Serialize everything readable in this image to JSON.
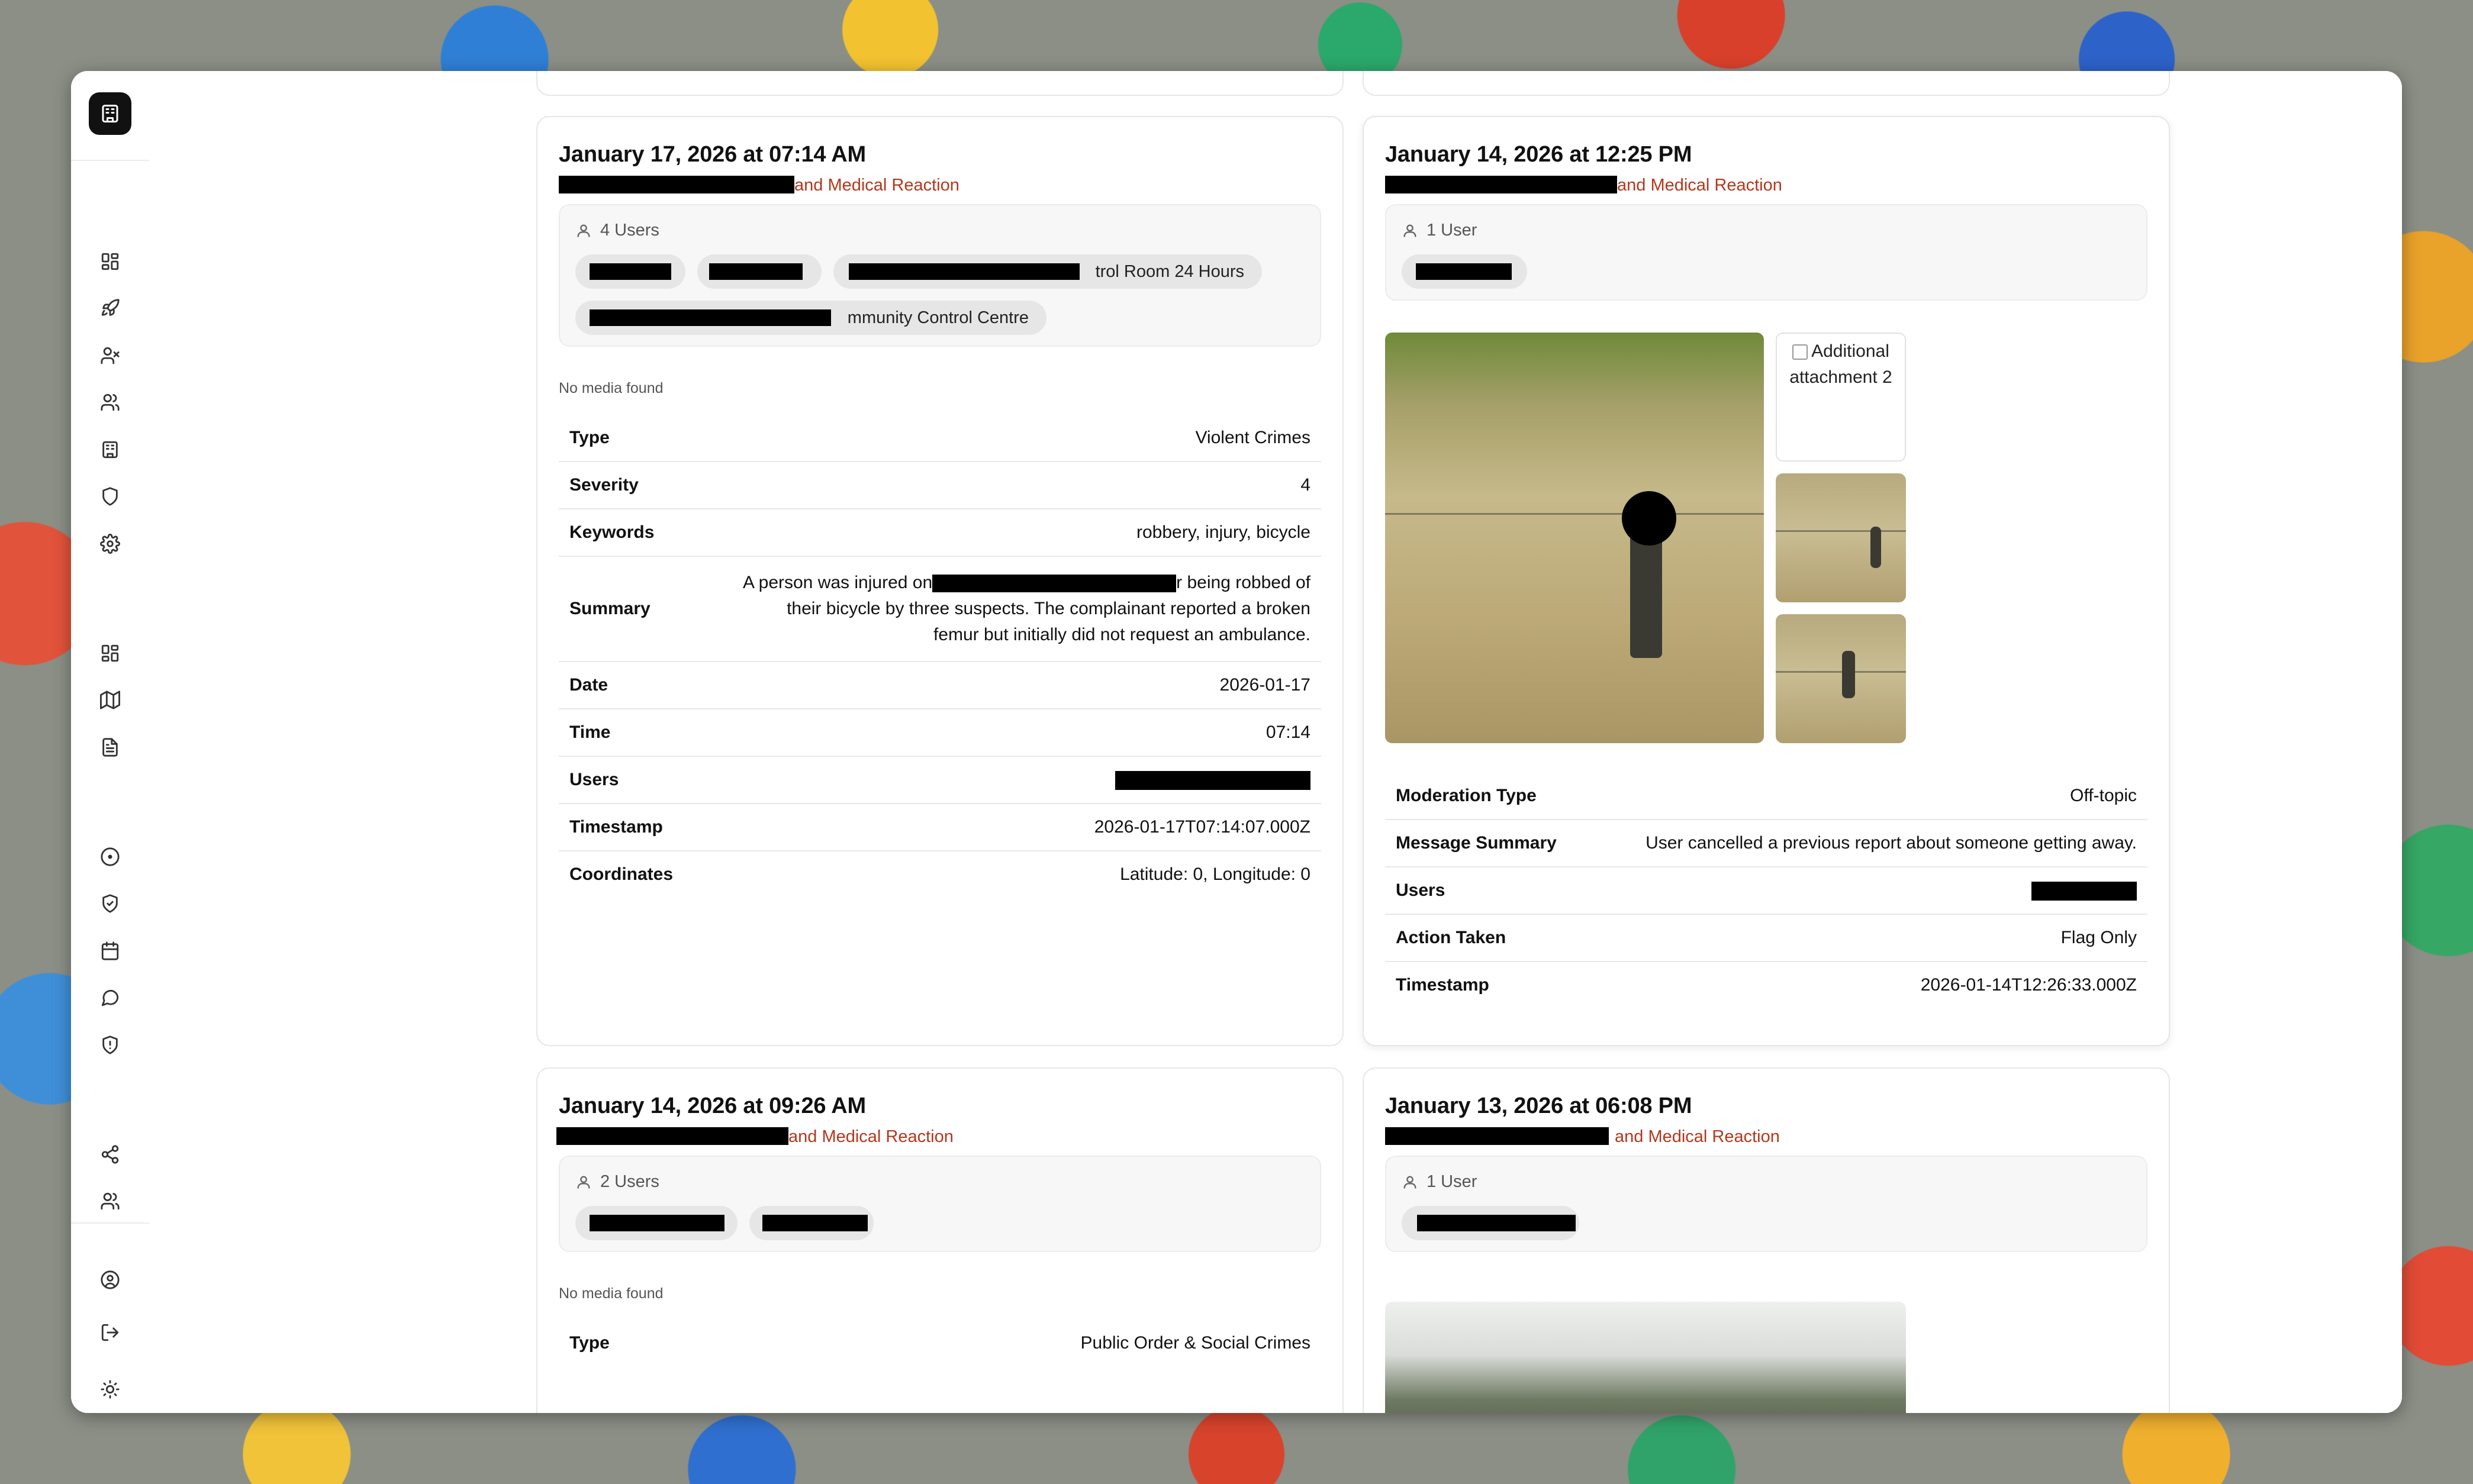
{
  "sidebar": {
    "logo_icon": "building-icon",
    "group1": [
      "dashboard-icon",
      "rocket-icon",
      "user-x-icon",
      "users-icon",
      "building-icon",
      "shield-icon",
      "settings-icon"
    ],
    "group2": [
      "dashboard-icon",
      "map-icon",
      "document-icon"
    ],
    "group3": [
      "alert-circle-icon",
      "shield-check-icon",
      "calendar-icon",
      "message-icon",
      "shield-alert-icon"
    ],
    "group4": [
      "share-icon",
      "users-icon"
    ],
    "bottom": [
      "user-circle-icon",
      "logout-icon",
      "sun-icon"
    ]
  },
  "cards": [
    {
      "title": "January 17, 2026 at 07:14 AM",
      "subtitle_visible": "and Medical Reaction",
      "users_label": "4 Users",
      "chips_visible": [
        "",
        "",
        "trol Room 24 Hours",
        "mmunity Control Centre"
      ],
      "media_text": "No media found",
      "rows": [
        {
          "k": "Type",
          "v": "Violent Crimes"
        },
        {
          "k": "Severity",
          "v": "4"
        },
        {
          "k": "Keywords",
          "v": "robbery, injury, bicycle"
        },
        {
          "k": "Summary",
          "v1": "A person was injured on",
          "v1b": "r being robbed of",
          "v2": "their bicycle by three suspects. The complainant reported a broken",
          "v3": "femur but initially did not request an ambulance."
        },
        {
          "k": "Date",
          "v": "2026-01-17"
        },
        {
          "k": "Time",
          "v": "07:14"
        },
        {
          "k": "Users",
          "v": ""
        },
        {
          "k": "Timestamp",
          "v": "2026-01-17T07:14:07.000Z"
        },
        {
          "k": "Coordinates",
          "v": "Latitude: 0, Longitude: 0"
        }
      ]
    },
    {
      "title": "January 14, 2026 at 12:25 PM",
      "subtitle_visible": "and Medical Reaction",
      "users_label": "1 User",
      "attachment_alt": "Additional attachment 2",
      "rows": [
        {
          "k": "Moderation Type",
          "v": "Off-topic"
        },
        {
          "k": "Message Summary",
          "v": "User cancelled a previous report about someone getting away."
        },
        {
          "k": "Users",
          "v": ""
        },
        {
          "k": "Action Taken",
          "v": "Flag Only"
        },
        {
          "k": "Timestamp",
          "v": "2026-01-14T12:26:33.000Z"
        }
      ]
    },
    {
      "title": "January 14, 2026 at 09:26 AM",
      "subtitle_visible": "and Medical Reaction",
      "users_label": "2 Users",
      "media_text": "No media found",
      "rows": [
        {
          "k": "Type",
          "v": "Public Order & Social Crimes"
        }
      ]
    },
    {
      "title": "January 13, 2026 at 06:08 PM",
      "subtitle_visible": "and Medical Reaction",
      "users_label": "1 User"
    }
  ],
  "colors": {
    "accent": "#b4371c",
    "chip_bg": "#e6e6e6",
    "box_bg": "#f7f7f7"
  }
}
